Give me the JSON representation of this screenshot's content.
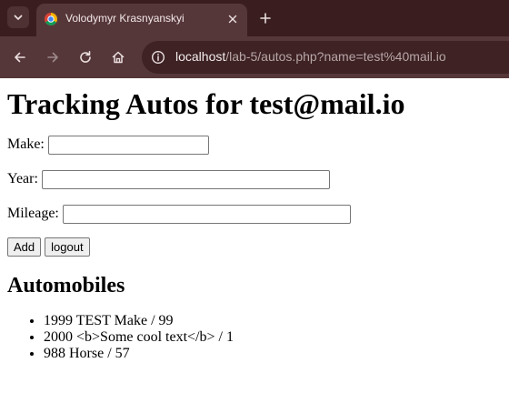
{
  "browser": {
    "tab_title": "Volodymyr Krasnyanskyi",
    "url_host": "localhost",
    "url_path": "/lab-5/autos.php?name=test%40mail.io",
    "icons": {
      "tab_list": "chevron-down-icon",
      "close": "close-icon",
      "new_tab": "plus-icon",
      "back": "arrow-left-icon",
      "forward": "arrow-right-icon",
      "reload": "reload-icon",
      "home": "home-icon",
      "site_info": "info-icon"
    }
  },
  "page": {
    "heading": "Tracking Autos for test@mail.io",
    "form": {
      "make_label": "Make:",
      "make_value": "",
      "year_label": "Year:",
      "year_value": "",
      "mileage_label": "Mileage:",
      "mileage_value": "",
      "add_button": "Add",
      "logout_button": "logout"
    },
    "autos_heading": "Automobiles",
    "autos": [
      "1999 TEST Make / 99",
      "2000 <b>Some cool text</b> / 1",
      "988 Horse / 57"
    ]
  },
  "colors": {
    "tabstrip_bg": "#3a1e1f",
    "toolbar_bg": "#563739",
    "omnibox_bg": "#3e2224"
  }
}
